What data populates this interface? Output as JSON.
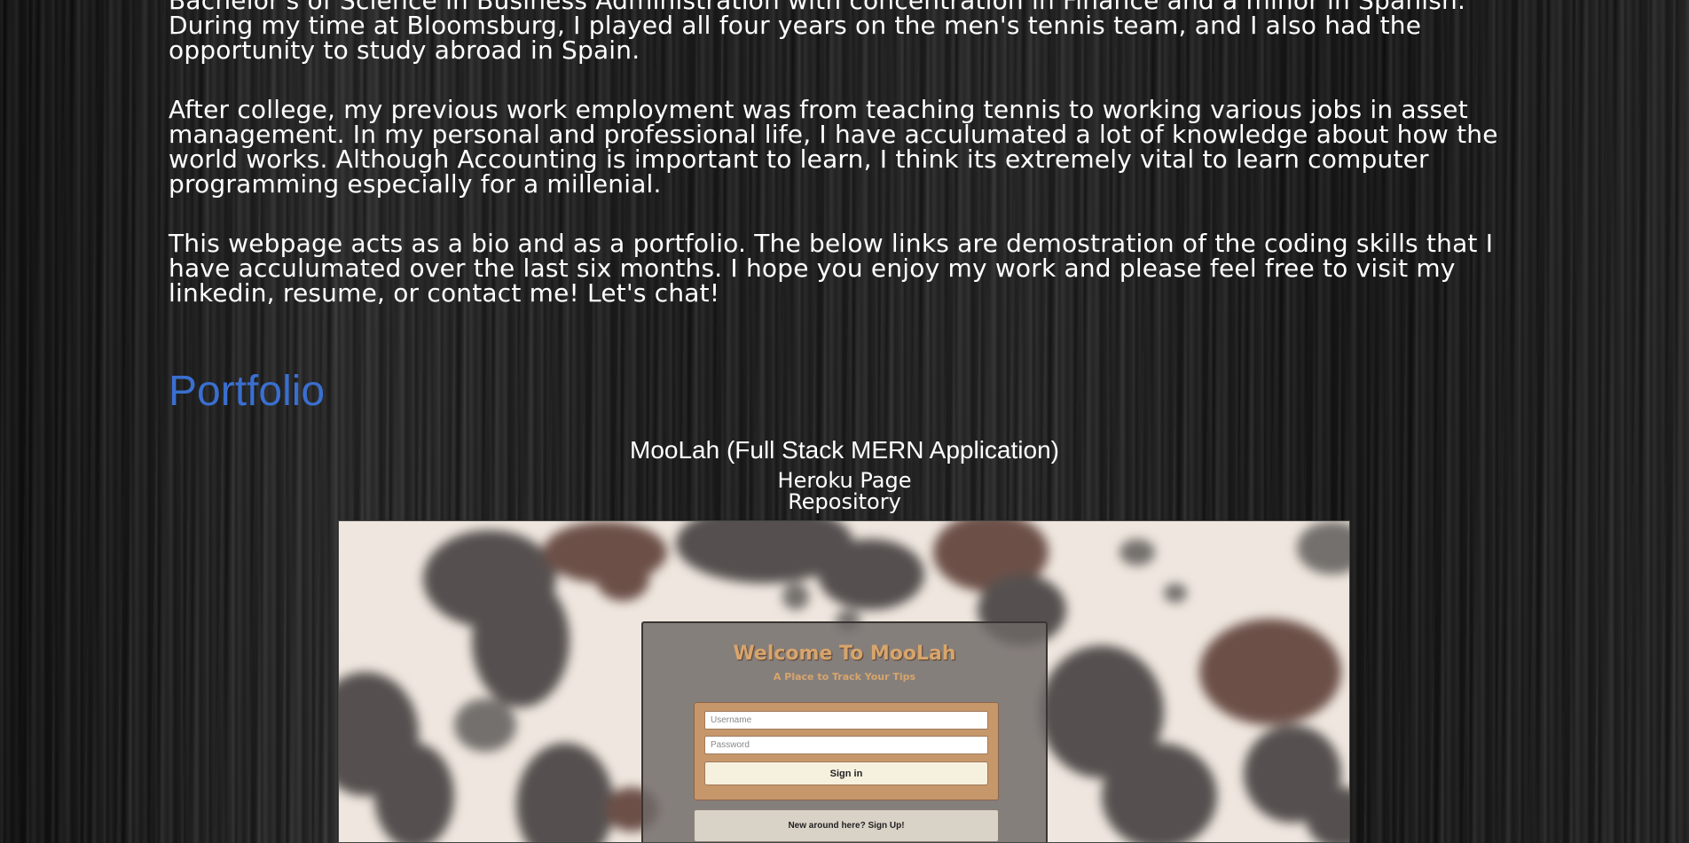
{
  "bio": {
    "paragraphs": [
      "Bachelor's of Science in Business Administration with concentration in Finance and a minor in Spanish. During my time at Bloomsburg, I played all four years on the men's tennis team, and I also had the opportunity to study abroad in Spain.",
      "After college, my previous work employment was from teaching tennis to working various jobs in asset management. In my personal and professional life, I have acculumated a lot of knowledge about how the world works. Although Accounting is important to learn, I think its extremely vital to learn computer programming especially for a millenial.",
      "This webpage acts as a bio and as a portfolio. The below links are demostration of the coding skills that I have acculumated over the last six months. I hope you enjoy my work and please feel free to visit my linkedin, resume, or contact me! Let's chat!"
    ]
  },
  "portfolio": {
    "heading": "Portfolio",
    "projects": [
      {
        "title": "MooLah (Full Stack MERN Application)",
        "links": [
          "Heroku Page",
          "Repository"
        ],
        "preview": {
          "title": "Welcome To MooLah",
          "subtitle": "A Place to Track Your Tips",
          "username_placeholder": "Username",
          "password_placeholder": "Password",
          "signin_label": "Sign in",
          "signup_label": "New around here? Sign Up!"
        }
      }
    ]
  },
  "colors": {
    "heading": "#3a6fd0",
    "text": "#ffffff",
    "moolah_accent": "#d7a56c",
    "form_background": "#c6976b"
  }
}
